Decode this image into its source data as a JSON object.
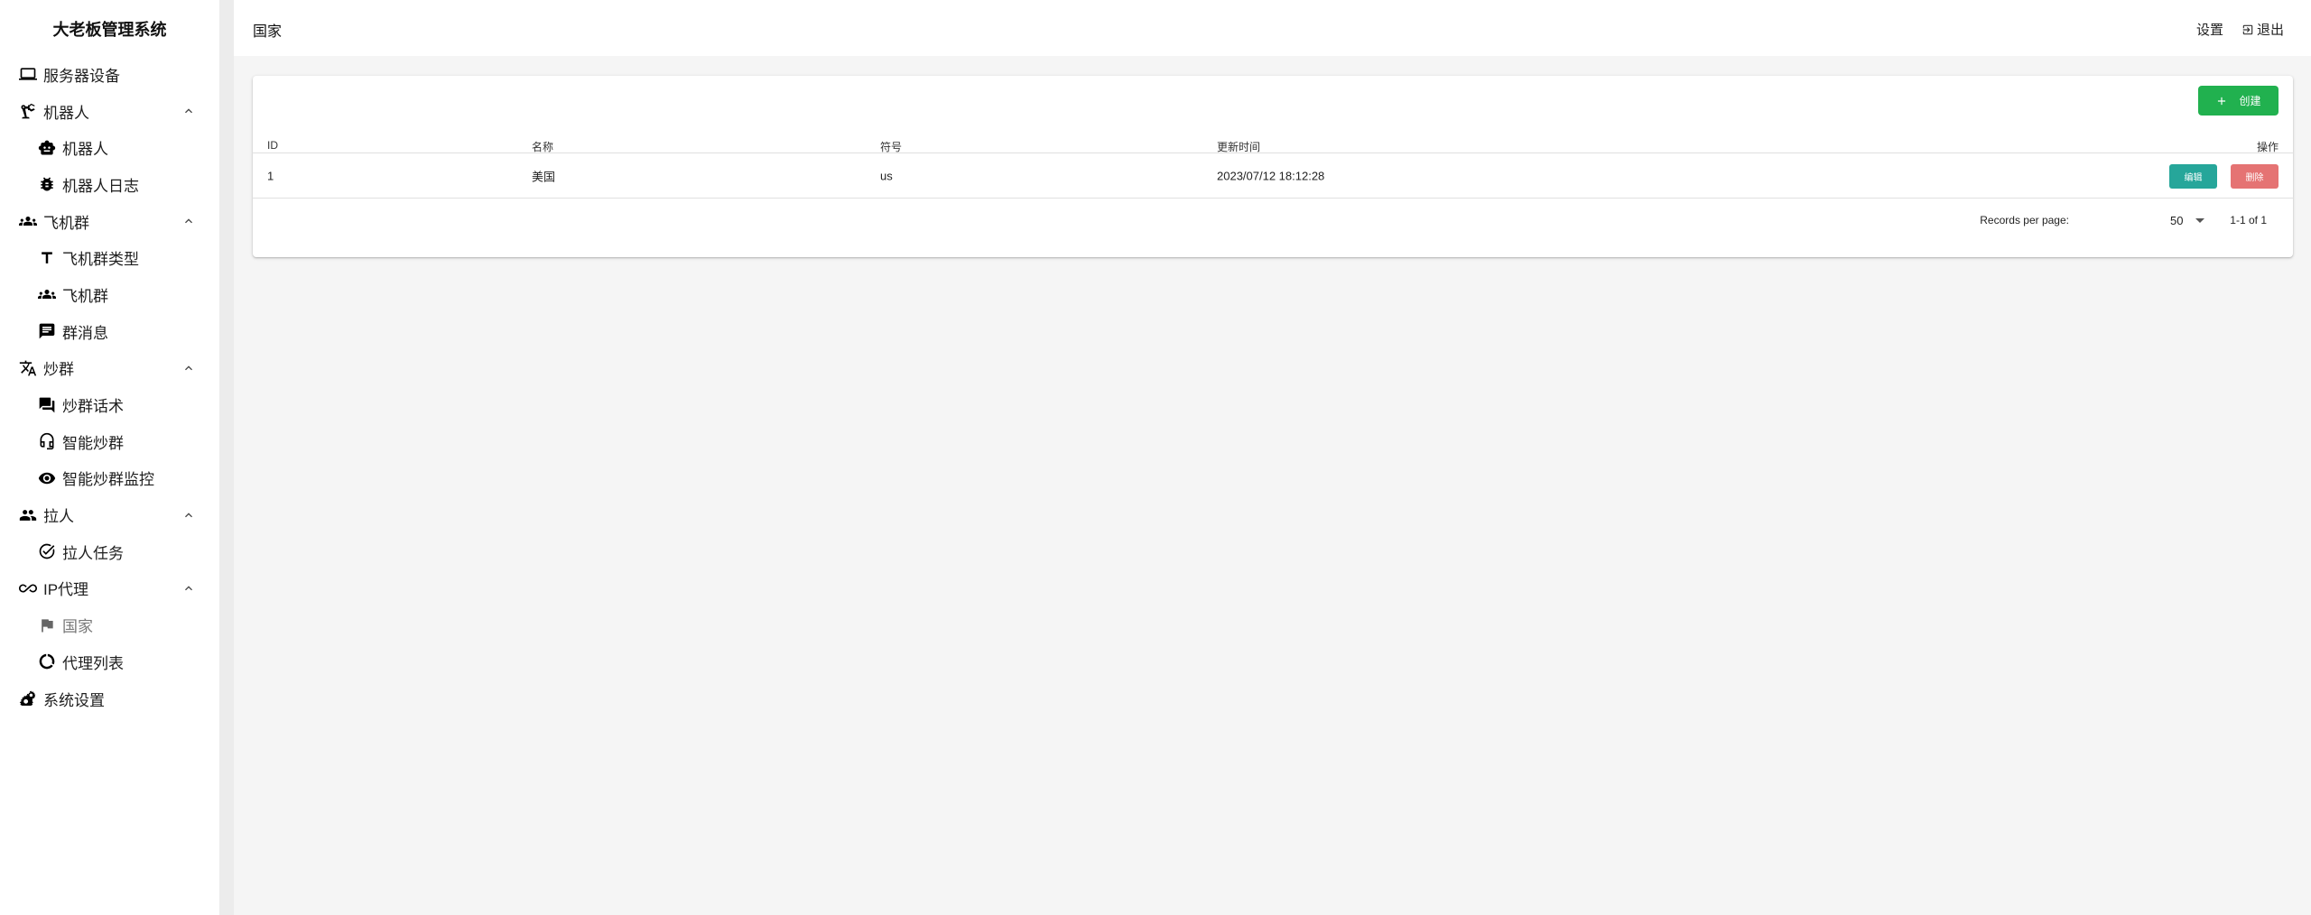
{
  "sidebar": {
    "brand": "大老板管理系统",
    "items": [
      {
        "label": "服务器设备"
      },
      {
        "label": "机器人"
      },
      {
        "label": "机器人"
      },
      {
        "label": "机器人日志"
      },
      {
        "label": "飞机群"
      },
      {
        "label": "飞机群类型"
      },
      {
        "label": "飞机群"
      },
      {
        "label": "群消息"
      },
      {
        "label": "炒群"
      },
      {
        "label": "炒群话术"
      },
      {
        "label": "智能炒群"
      },
      {
        "label": "智能炒群监控"
      },
      {
        "label": "拉人"
      },
      {
        "label": "拉人任务"
      },
      {
        "label": "IP代理"
      },
      {
        "label": "国家"
      },
      {
        "label": "代理列表"
      },
      {
        "label": "系统设置"
      }
    ]
  },
  "header": {
    "title": "国家",
    "settings": "设置",
    "logout": "退出"
  },
  "toolbar": {
    "create_label": "创建"
  },
  "table": {
    "columns": [
      "ID",
      "名称",
      "符号",
      "更新时间",
      "操作"
    ],
    "rows": [
      {
        "id": "1",
        "name": "美国",
        "symbol": "us",
        "updated": "2023/07/12 18:12:28",
        "edit": "编辑",
        "delete": "删除"
      }
    ]
  },
  "pagination": {
    "records_label": "Records per page:",
    "per_page": "50",
    "range": "1-1 of 1"
  },
  "colors": {
    "create": "#21b14f",
    "edit": "#26a69a",
    "delete": "#e57373"
  }
}
